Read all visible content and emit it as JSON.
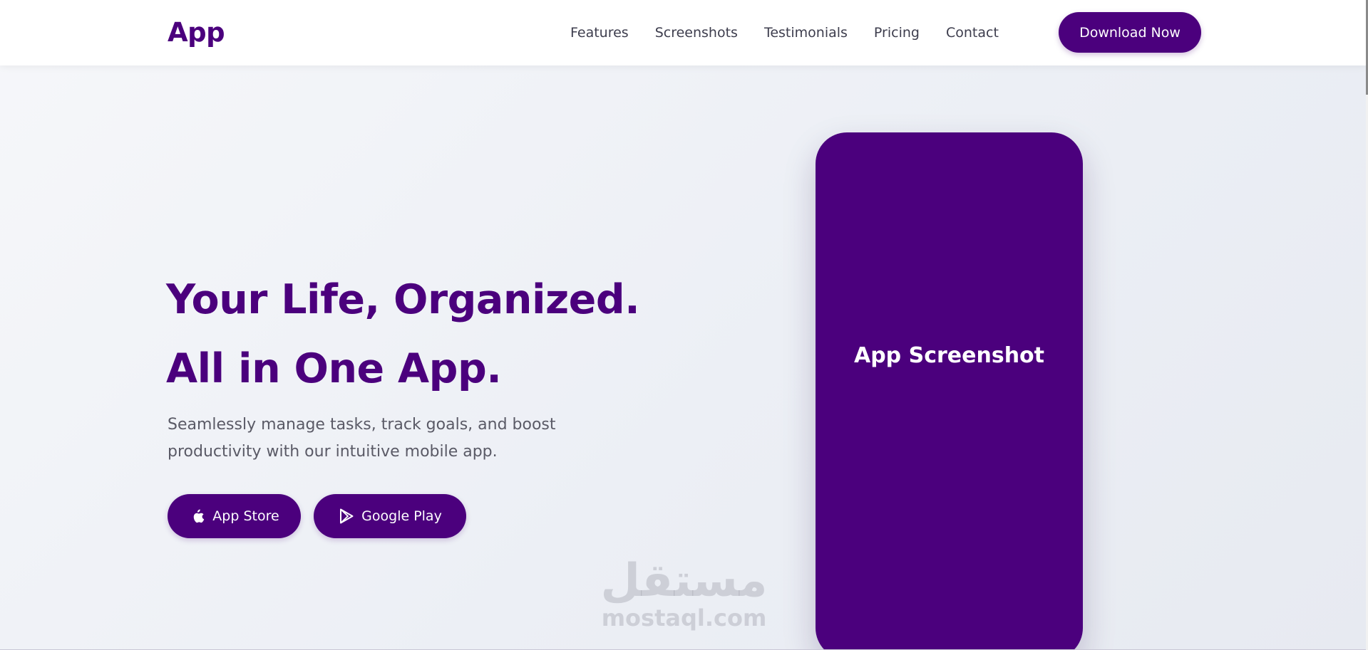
{
  "header": {
    "logo": "App",
    "nav": [
      {
        "label": "Features"
      },
      {
        "label": "Screenshots"
      },
      {
        "label": "Testimonials"
      },
      {
        "label": "Pricing"
      },
      {
        "label": "Contact"
      }
    ],
    "cta_label": "Download Now"
  },
  "hero": {
    "title_line1": "Your Life, Organized.",
    "title_line2": "All in One App.",
    "subtitle": "Seamlessly manage tasks, track goals, and boost productivity with our intuitive mobile app.",
    "buttons": [
      {
        "label": "App Store",
        "icon": "apple-icon"
      },
      {
        "label": "Google Play",
        "icon": "google-play-icon"
      }
    ]
  },
  "phone": {
    "label": "App Screenshot"
  },
  "watermark": {
    "arabic": "مستقل",
    "latin": "mostaql.com"
  },
  "colors": {
    "brand": "#4b007d",
    "text_muted": "#5a5a66",
    "nav_text": "#3d3d4d",
    "background": "#eef0f5"
  }
}
